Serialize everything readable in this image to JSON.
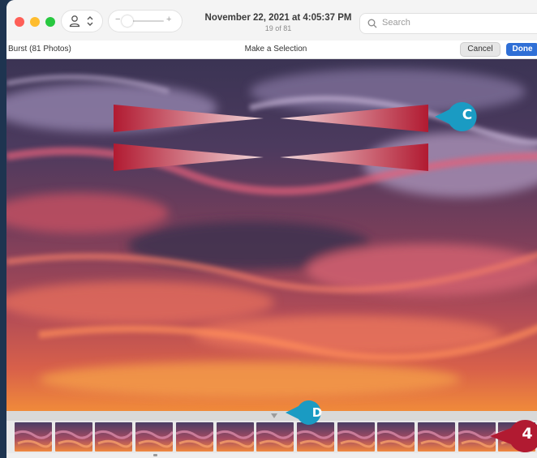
{
  "window": {
    "date": "November 22, 2021 at 4:05:37 PM",
    "count": "19 of 81",
    "search_placeholder": "Search"
  },
  "toolbar": {
    "burst_label": "Burst (81 Photos)",
    "selection_label": "Make a Selection",
    "cancel_label": "Cancel",
    "done_label": "Done"
  },
  "filmstrip": {
    "thumbnail_count": 14
  },
  "callouts": {
    "c": "C",
    "d": "D",
    "step": "4"
  },
  "colors": {
    "callout_teal": "#1a9bc3",
    "callout_red": "#b11a31",
    "done_blue": "#2f6fd6"
  },
  "icons": [
    "person-icon",
    "chevron-updown-icon",
    "search-icon"
  ]
}
